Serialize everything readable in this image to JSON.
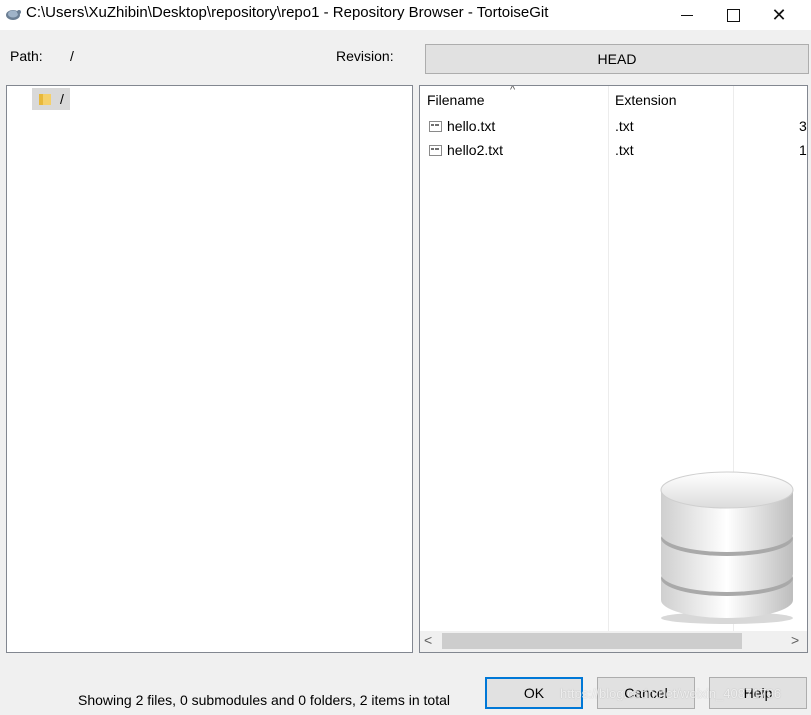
{
  "window": {
    "title": "C:\\Users\\XuZhibin\\Desktop\\repository\\repo1 - Repository Browser - TortoiseGit",
    "app_icon": "tortoisegit-icon",
    "minimize_icon": "minimize-icon",
    "maximize_icon": "maximize-icon",
    "close_icon": "close-icon",
    "close_glyph": "✕"
  },
  "path": {
    "label": "Path:",
    "value": "/"
  },
  "revision": {
    "label": "Revision:",
    "value": "HEAD"
  },
  "tree": {
    "items": [
      {
        "label": "/",
        "icon": "folder-icon"
      }
    ]
  },
  "list": {
    "columns": {
      "filename": "Filename",
      "extension": "Extension"
    },
    "sort_indicator": "^",
    "rows": [
      {
        "name": "hello.txt",
        "extension": ".txt",
        "size": "3",
        "icon": "text-file-icon"
      },
      {
        "name": "hello2.txt",
        "extension": ".txt",
        "size": "1",
        "icon": "text-file-icon"
      }
    ],
    "scroll_left": "<",
    "scroll_right": ">"
  },
  "status": "Showing 2 files, 0 submodules and 0 folders, 2 items in total",
  "buttons": {
    "ok": "OK",
    "cancel": "Cancel",
    "help": "Help"
  },
  "watermark": "https://blog.csdn.net/weixin_40871796",
  "colors": {
    "focus_border": "#0078d7",
    "selection": "#d9d9d9"
  }
}
